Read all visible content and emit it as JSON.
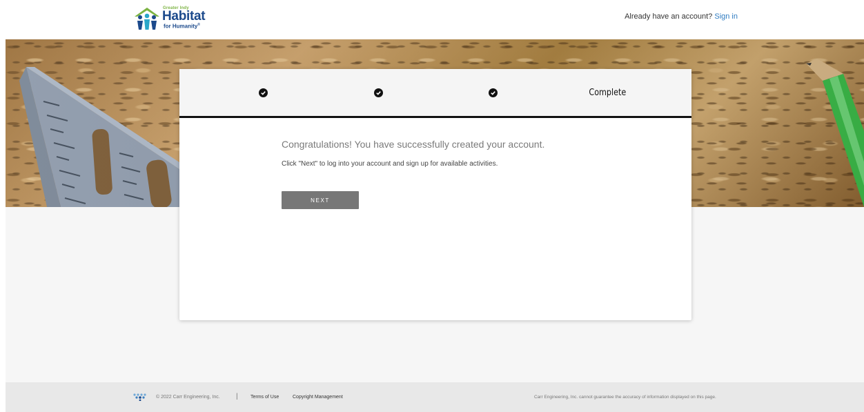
{
  "header": {
    "logo": {
      "tagline": "Greater Indy",
      "wordmark": "Habitat",
      "subline": "for Humanity",
      "mark": "®",
      "brand_color": "#1c4a8c",
      "accent_color": "#7cb342"
    },
    "account_prompt": "Already have an account?",
    "signin_label": "Sign in",
    "link_color": "#2f7cc1"
  },
  "wizard": {
    "steps": [
      {
        "status": "done",
        "icon": "check-circle-icon"
      },
      {
        "status": "done",
        "icon": "check-circle-icon"
      },
      {
        "status": "done",
        "icon": "check-circle-icon"
      },
      {
        "status": "current",
        "label": "Complete"
      }
    ],
    "message": "Congratulations! You have successfully created your account.",
    "hint": "Click \"Next\" to log into your account and sign up for available activities.",
    "next_label": "NEXT"
  },
  "footer": {
    "logo_icon": "carr-diamond-dots-icon",
    "copyright": "© 2022 Carr Engineering, Inc.",
    "separator": "|",
    "links": [
      "Terms of Use",
      "Copyright Management"
    ],
    "disclaimer": "Carr Engineering, Inc. cannot guarantee the accuracy of information displayed on this page."
  }
}
